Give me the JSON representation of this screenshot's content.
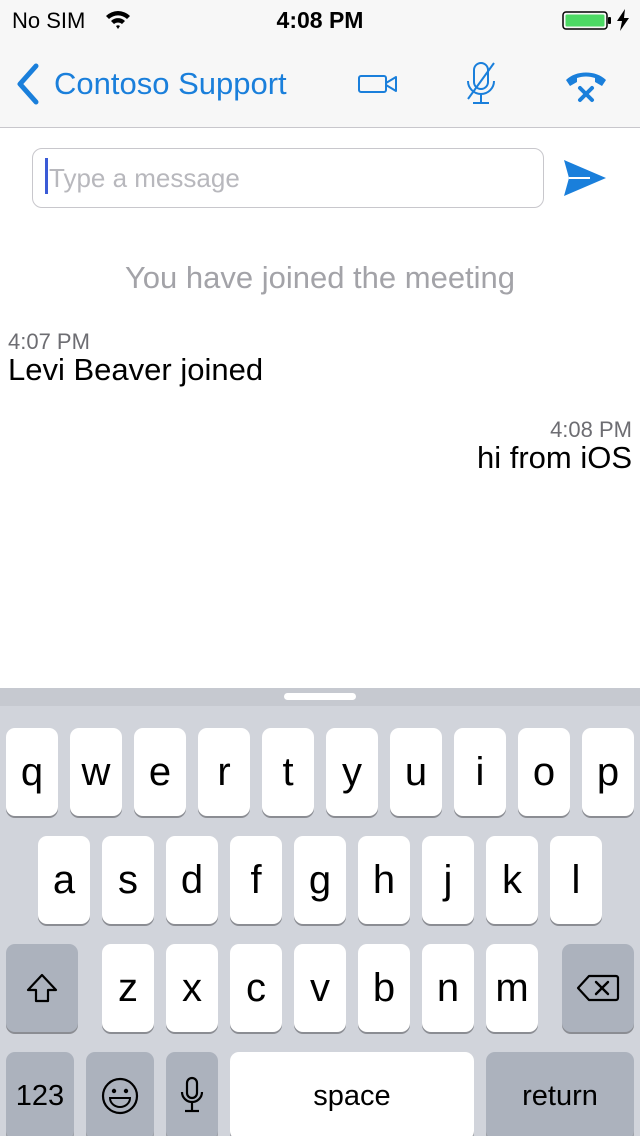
{
  "status_bar": {
    "carrier": "No SIM",
    "time": "4:08 PM"
  },
  "nav": {
    "back_label": "Contoso Support",
    "icons": [
      "chevron-left-icon",
      "video-camera-icon",
      "microphone-muted-icon",
      "hang-up-icon"
    ],
    "accent_color": "#1a7fdb"
  },
  "compose": {
    "placeholder": "Type a message",
    "value": ""
  },
  "messages": {
    "system_notice": "You have joined the meeting",
    "items": [
      {
        "time": "4:07 PM",
        "text": "Levi Beaver joined",
        "align": "left"
      },
      {
        "time": "4:08 PM",
        "text": "hi from iOS",
        "align": "right"
      }
    ]
  },
  "keyboard": {
    "row1": [
      "q",
      "w",
      "e",
      "r",
      "t",
      "y",
      "u",
      "i",
      "o",
      "p"
    ],
    "row2": [
      "a",
      "s",
      "d",
      "f",
      "g",
      "h",
      "j",
      "k",
      "l"
    ],
    "row3": [
      "z",
      "x",
      "c",
      "v",
      "b",
      "n",
      "m"
    ],
    "numbers_label": "123",
    "space_label": "space",
    "return_label": "return"
  }
}
